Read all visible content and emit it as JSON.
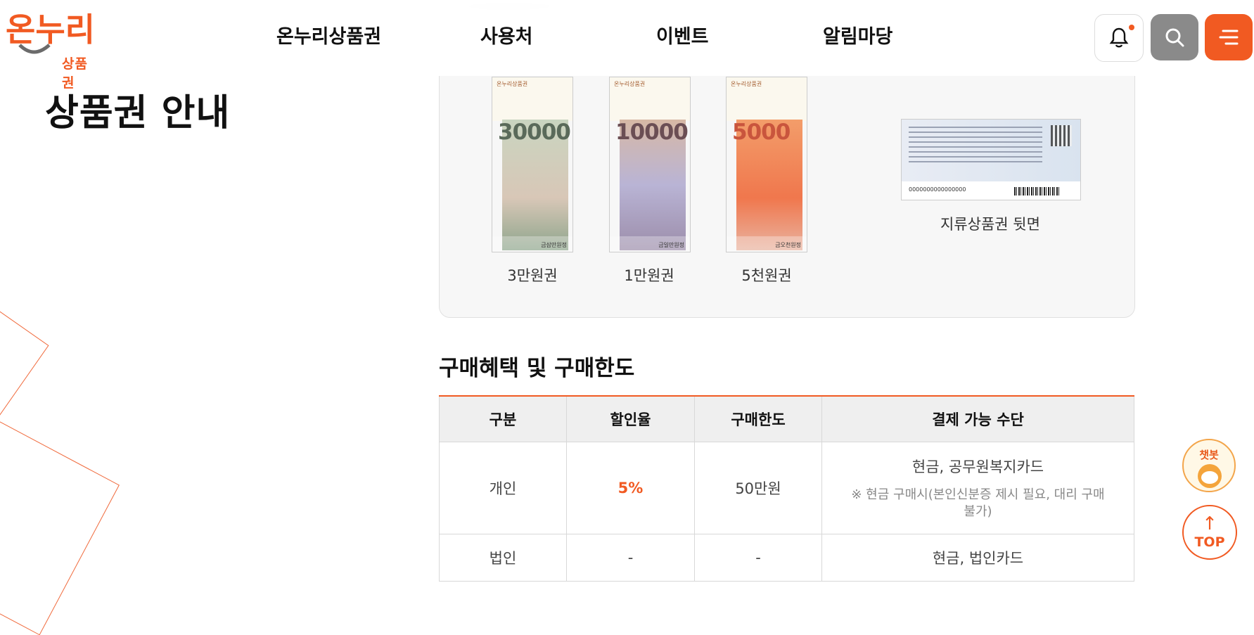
{
  "header": {
    "logo_text": "온누리",
    "logo_sub": "상품권",
    "nav": [
      "온누리상품권",
      "사용처",
      "이벤트",
      "알림마당"
    ]
  },
  "page": {
    "title": "상품권 안내"
  },
  "vouchers": [
    {
      "number": "30000",
      "label": "3만원권",
      "brand": "온누리상품권",
      "amount_text": "금삼만원정"
    },
    {
      "number": "10000",
      "label": "1만원권",
      "brand": "온누리상품권",
      "amount_text": "금일만원정"
    },
    {
      "number": "5000",
      "label": "5천원권",
      "brand": "온누리상품권",
      "amount_text": "금오천원정"
    }
  ],
  "back": {
    "label": "지류상품권 뒷면",
    "serial": "0000000000000000"
  },
  "purchase": {
    "title": "구매혜택 및 구매한도",
    "headers": [
      "구분",
      "할인율",
      "구매한도",
      "결제 가능 수단"
    ],
    "rows": [
      {
        "type": "개인",
        "rate": "5%",
        "limit": "50만원",
        "payment": "현금, 공무원복지카드",
        "note": "※ 현금 구매시(본인신분증 제시 필요, 대리 구매 불가)"
      },
      {
        "type": "법인",
        "rate": "-",
        "limit": "-",
        "payment": "현금, 법인카드",
        "note": ""
      }
    ]
  },
  "floating": {
    "chatbot": "챗봇",
    "top": "TOP"
  },
  "colors": {
    "accent": "#f15a22",
    "gray_button": "#8a8a8a"
  }
}
